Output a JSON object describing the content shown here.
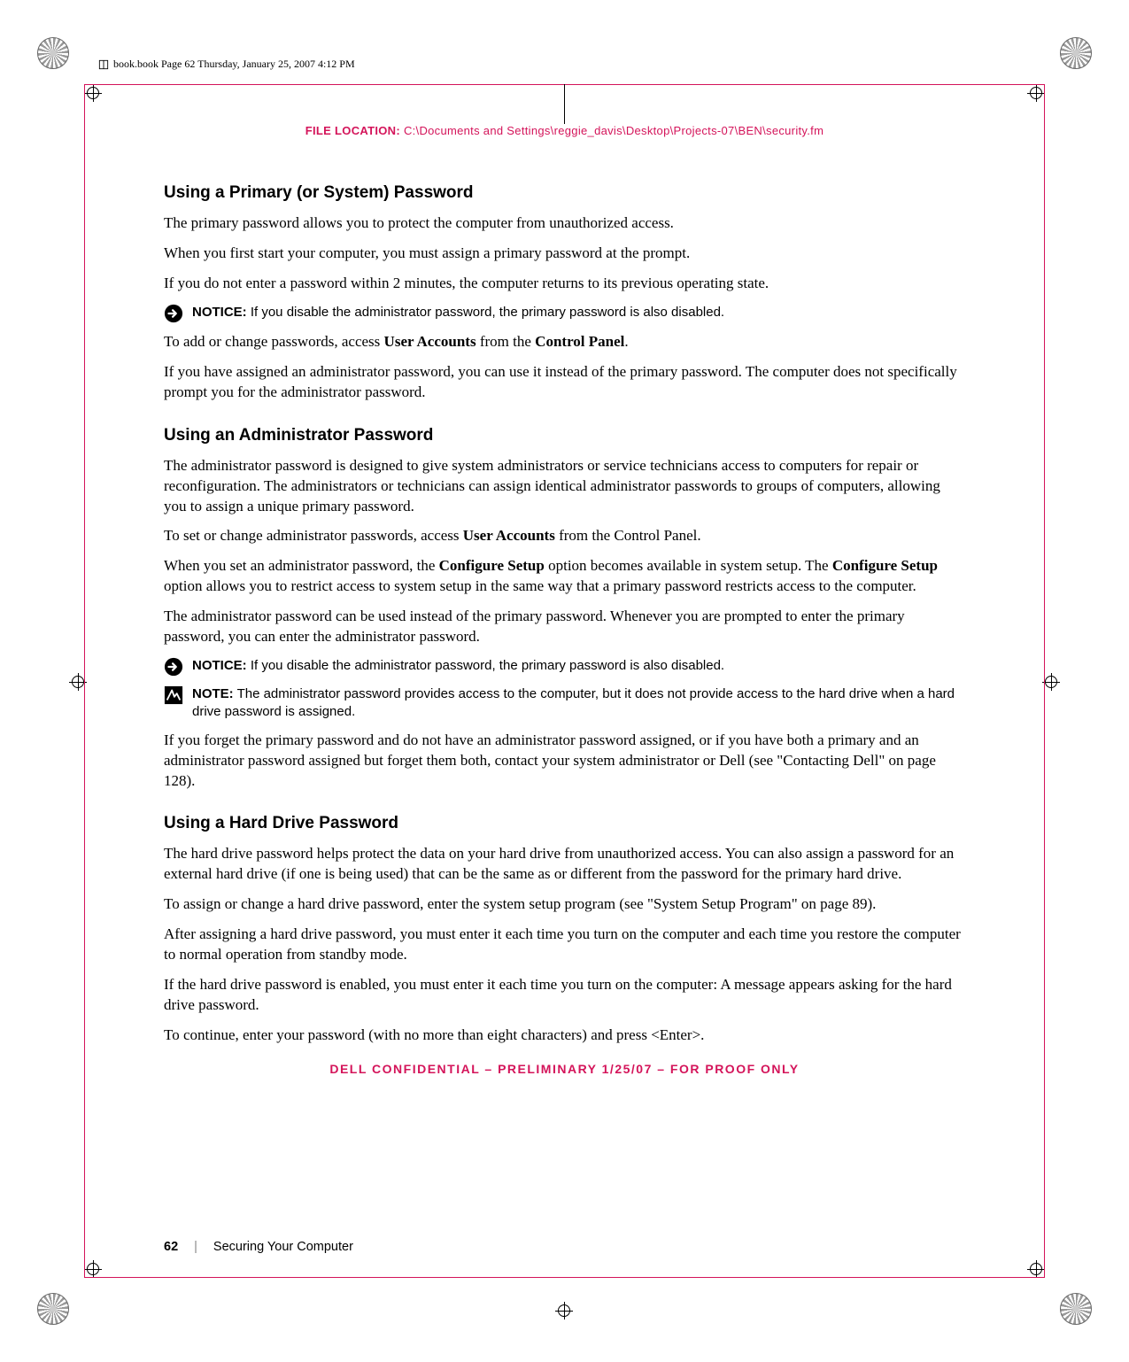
{
  "header": {
    "page_info": "book.book  Page 62  Thursday, January 25, 2007  4:12 PM"
  },
  "file_location": {
    "label": "FILE LOCATION:",
    "path": "C:\\Documents and Settings\\reggie_davis\\Desktop\\Projects-07\\BEN\\security.fm"
  },
  "section1": {
    "heading": "Using a Primary (or System) Password",
    "p1": "The primary password allows you to protect the computer from unauthorized access.",
    "p2": "When you first start your computer, you must assign a primary password at the prompt.",
    "p3": "If you do not enter a password within 2 minutes, the computer returns to its previous operating state.",
    "notice1_label": "NOTICE:",
    "notice1_text": " If you disable the administrator password, the primary password is also disabled.",
    "p4_pre": "To add or change passwords, access ",
    "p4_bold1": "User Accounts",
    "p4_mid": " from the ",
    "p4_bold2": "Control Panel",
    "p4_post": ".",
    "p5": "If you have assigned an administrator password, you can use it instead of the primary password. The computer does not specifically prompt you for the administrator password."
  },
  "section2": {
    "heading": "Using an Administrator Password",
    "p1": "The administrator password is designed to give system administrators or service technicians access to computers for repair or reconfiguration. The administrators or technicians can assign identical administrator passwords to groups of computers, allowing you to assign a unique primary password.",
    "p2_pre": "To set or change administrator passwords, access ",
    "p2_bold": "User Accounts",
    "p2_post": " from the Control Panel.",
    "p3_pre": "When you set an administrator password, the ",
    "p3_bold1": "Configure Setup",
    "p3_mid": " option becomes available in system setup. The ",
    "p3_bold2": "Configure Setup",
    "p3_post": " option allows you to restrict access to system setup in the same way that a primary password restricts access to the computer.",
    "p4": "The administrator password can be used instead of the primary password. Whenever you are prompted to enter the primary password, you can enter the administrator password.",
    "notice1_label": "NOTICE:",
    "notice1_text": " If you disable the administrator password, the primary password is also disabled.",
    "note1_label": "NOTE:",
    "note1_text": " The administrator password provides access to the computer, but it does not provide access to the hard drive when a hard drive password is assigned.",
    "p5": "If you forget the primary password and do not have an administrator password assigned, or if you have both a primary and an administrator password assigned but forget them both, contact your system administrator or Dell (see \"Contacting Dell\" on page 128)."
  },
  "section3": {
    "heading": "Using a Hard Drive Password",
    "p1": "The hard drive password helps protect the data on your hard drive from unauthorized access. You can also assign a password for an external hard drive (if one is being used) that can be the same as or different from the password for the primary hard drive.",
    "p2": "To assign or change a hard drive password, enter the system setup program (see \"System Setup Program\" on page 89).",
    "p3": "After assigning a hard drive password, you must enter it each time you turn on the computer and each time you restore the computer to normal operation from standby mode.",
    "p4": "If the hard drive password is enabled, you must enter it each time you turn on the computer: A message appears asking for the hard drive password.",
    "p5": "To continue, enter your password (with no more than eight characters) and press <Enter>."
  },
  "confidential": "DELL CONFIDENTIAL – PRELIMINARY 1/25/07 – FOR PROOF ONLY",
  "footer": {
    "page": "62",
    "section": "Securing Your Computer"
  }
}
